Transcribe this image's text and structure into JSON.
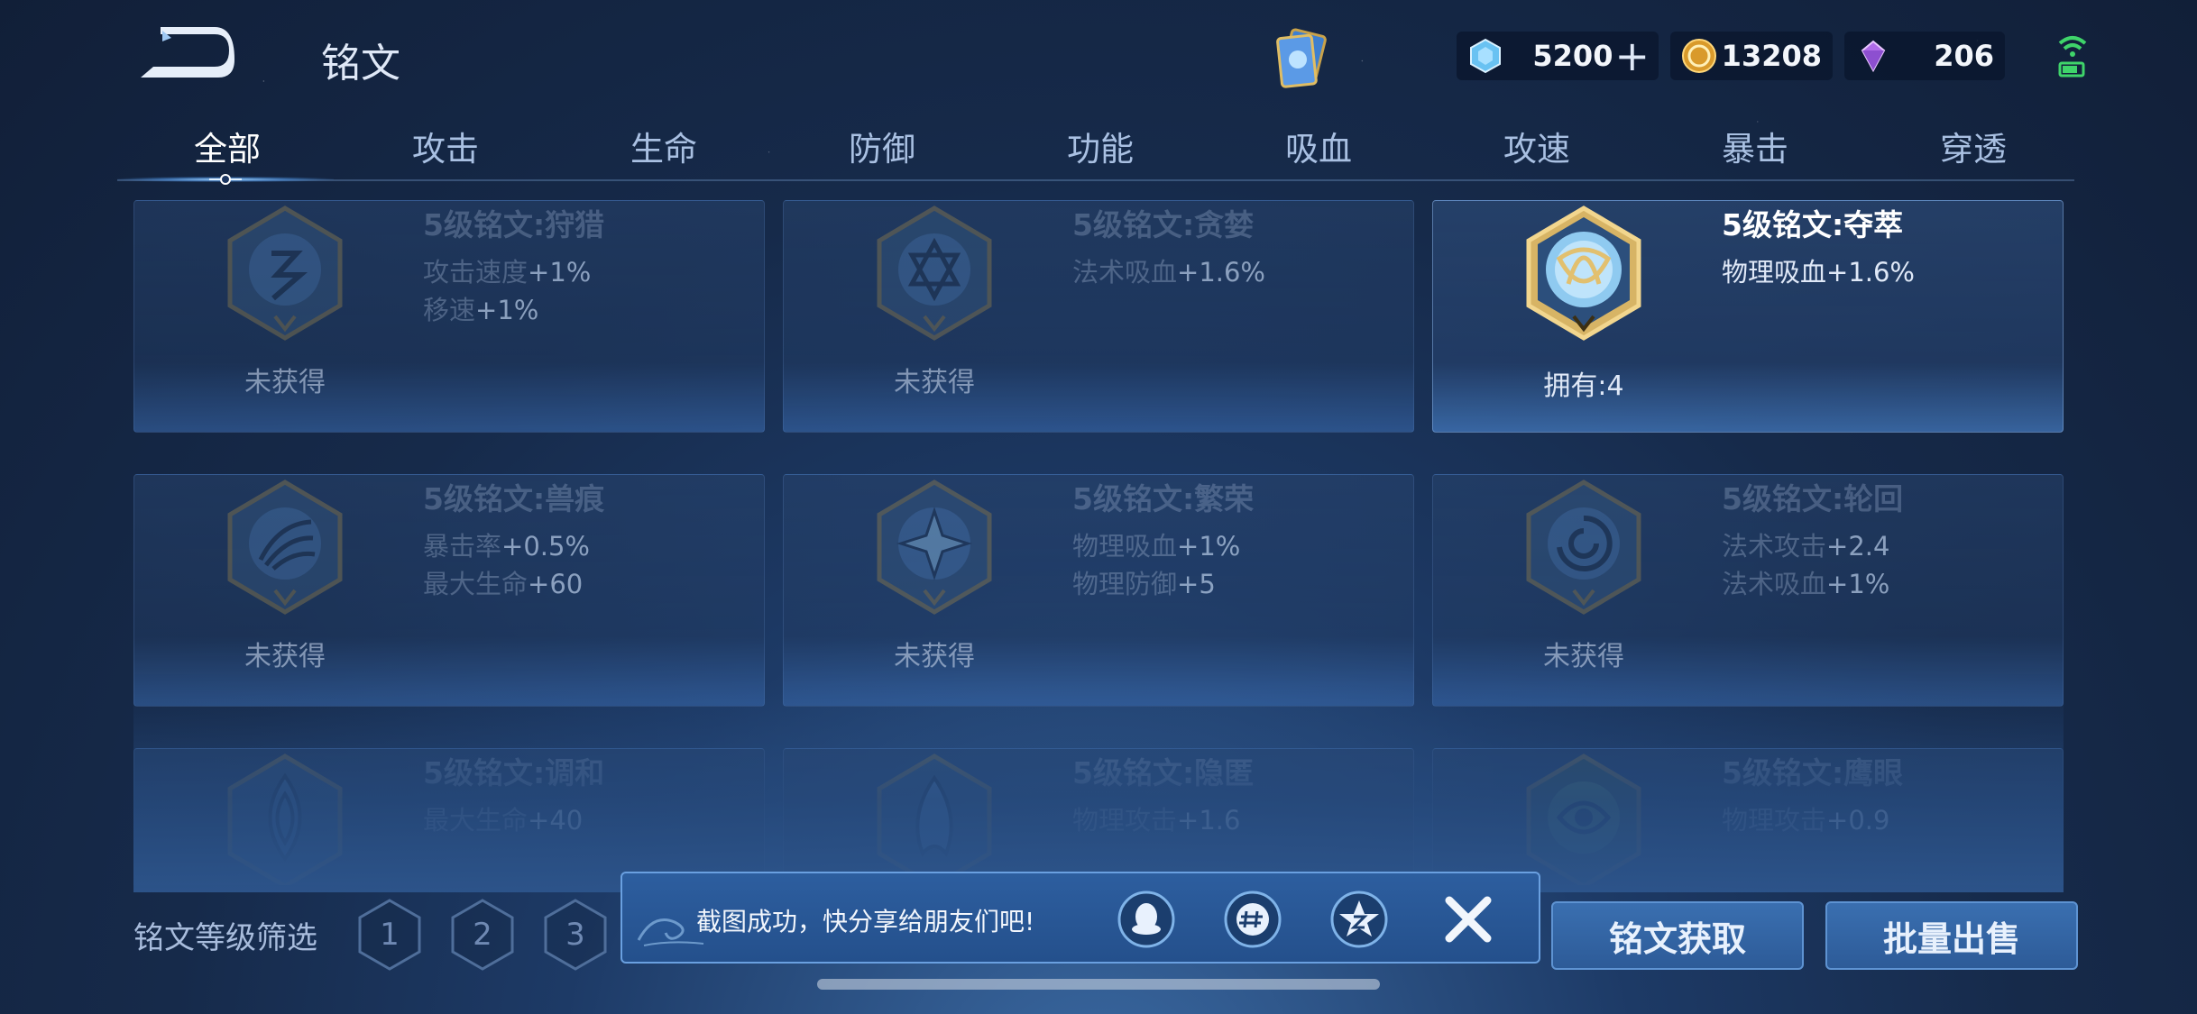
{
  "header": {
    "title": "铭文",
    "currencies": [
      {
        "icon": "diamond-currency-icon",
        "value": "5200",
        "has_plus": true
      },
      {
        "icon": "gold-coin-icon",
        "value": "13208"
      },
      {
        "icon": "purple-crystal-icon",
        "value": "206"
      }
    ],
    "plus_glyph": "+"
  },
  "tabs": [
    "全部",
    "攻击",
    "生命",
    "防御",
    "功能",
    "吸血",
    "攻速",
    "暴击",
    "穿透"
  ],
  "active_tab": "全部",
  "runes": [
    {
      "name": "5级铭文:狩猎",
      "attrs": [
        [
          "攻击速度",
          "+1%"
        ],
        [
          "移速",
          "+1%"
        ]
      ],
      "status": "未获得",
      "owned": false,
      "color": "#4a78b0"
    },
    {
      "name": "5级铭文:贪婪",
      "attrs": [
        [
          "法术吸血",
          "+1.6%"
        ]
      ],
      "status": "未获得",
      "owned": false,
      "color": "#4a78b0"
    },
    {
      "name": "5级铭文:夺萃",
      "attrs": [
        [
          "物理吸血",
          "+1.6%"
        ]
      ],
      "status": "拥有:4",
      "owned": true,
      "color": "#6fb2e6"
    },
    {
      "name": "5级铭文:兽痕",
      "attrs": [
        [
          "暴击率",
          "+0.5%"
        ],
        [
          "最大生命",
          "+60"
        ]
      ],
      "status": "未获得",
      "owned": false,
      "color": "#4a78b0"
    },
    {
      "name": "5级铭文:繁荣",
      "attrs": [
        [
          "物理吸血",
          "+1%"
        ],
        [
          "物理防御",
          "+5"
        ]
      ],
      "status": "未获得",
      "owned": false,
      "color": "#4a78b0"
    },
    {
      "name": "5级铭文:轮回",
      "attrs": [
        [
          "法术攻击",
          "+2.4"
        ],
        [
          "法术吸血",
          "+1%"
        ]
      ],
      "status": "未获得",
      "owned": false,
      "color": "#4a78b0"
    },
    {
      "name": "5级铭文:调和",
      "attrs": [
        [
          "最大生命",
          "+40"
        ]
      ],
      "status": "",
      "owned": false,
      "color": "#4a78b0"
    },
    {
      "name": "5级铭文:隐匿",
      "attrs": [
        [
          "物理攻击",
          "+1.6"
        ]
      ],
      "status": "",
      "owned": false,
      "color": "#4a78b0"
    },
    {
      "name": "5级铭文:鹰眼",
      "attrs": [
        [
          "物理攻击",
          "+0.9"
        ]
      ],
      "status": "",
      "owned": false,
      "color": "#5a8f70"
    }
  ],
  "bottom": {
    "filter_label": "铭文等级筛选",
    "levels": [
      "1",
      "2",
      "3"
    ],
    "obtain_button": "铭文获取",
    "bulk_sell_button": "批量出售"
  },
  "toast": {
    "message": "截图成功，快分享给朋友们吧!",
    "share_targets": [
      "qq-icon",
      "wechat-moments-icon",
      "qzone-icon"
    ],
    "close_icon": "close-icon"
  }
}
